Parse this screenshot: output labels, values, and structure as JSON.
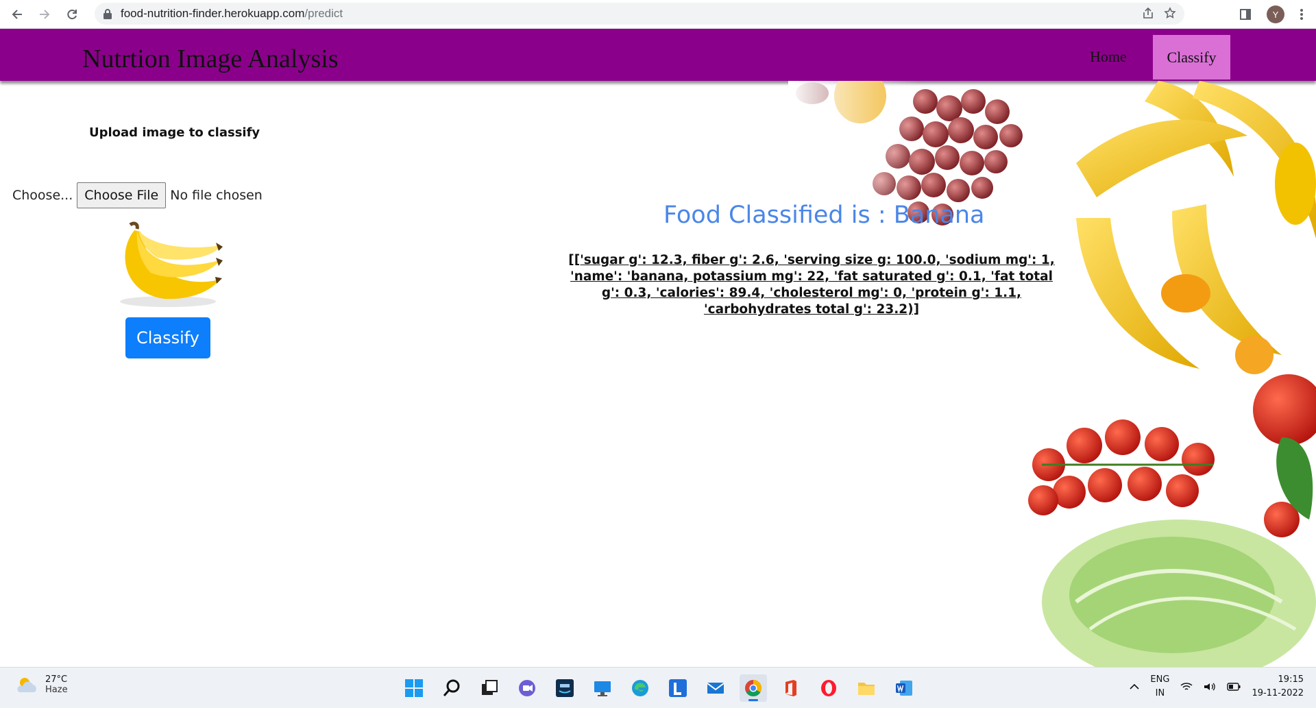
{
  "browser": {
    "url_host": "food-nutrition-finder.herokuapp.com",
    "url_path": "/predict",
    "profile_initial": "Y"
  },
  "navbar": {
    "brand": "Nutrtion Image Analysis",
    "home_label": "Home",
    "classify_label": "Classify",
    "background_color": "#8b008b",
    "active_color": "#da70d6"
  },
  "upload": {
    "heading": "Upload image to classify",
    "choose_label": "Choose...",
    "file_button_label": "Choose File",
    "file_status": "No file chosen",
    "classify_button_label": "Classify",
    "button_color": "#0d7efc"
  },
  "result": {
    "title": "Food Classified is : Banana",
    "nutrition_json": "[['sugar g': 12.3, fiber g': 2.6, 'serving size g: 100.0, 'sodium mg': 1, 'name': 'banana, potassium mg': 22, 'fat saturated g': 0.1, 'fat total g': 0.3, 'calories': 89.4, 'cholesterol mg': 0, 'protein g': 1.1, 'carbohydrates total g': 23.2)]",
    "title_color": "#4a86e8"
  },
  "taskbar": {
    "temperature": "27°C",
    "condition": "Haze",
    "language": "ENG",
    "region": "IN",
    "time": "19:15",
    "date": "19-11-2022"
  }
}
